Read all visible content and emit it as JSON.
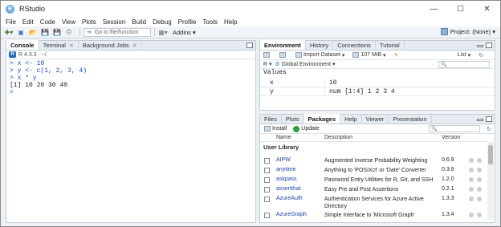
{
  "window": {
    "title": "RStudio",
    "app_icon": "R"
  },
  "menu": [
    "File",
    "Edit",
    "Code",
    "View",
    "Plots",
    "Session",
    "Build",
    "Debug",
    "Profile",
    "Tools",
    "Help"
  ],
  "toolbar": {
    "goto_placeholder": "Go to file/function",
    "addins": "Addins",
    "project": "Project: (None)"
  },
  "console_pane": {
    "tabs": [
      "Console",
      "Terminal",
      "Background Jobs"
    ],
    "r_version": "R 4.3.3 · ~/",
    "lines": [
      {
        "text": "> x <- 10",
        "kind": "cmd"
      },
      {
        "text": "> y <- c(1, 2, 3, 4)",
        "kind": "cmd"
      },
      {
        "text": "> x * y",
        "kind": "cmd"
      },
      {
        "text": "[1] 10 20 30 40",
        "kind": "out"
      },
      {
        "text": ">",
        "kind": "cmd"
      }
    ]
  },
  "env_pane": {
    "tabs": [
      "Environment",
      "History",
      "Connections",
      "Tutorial"
    ],
    "import_label": "Import Dataset",
    "memory": "107 MiB",
    "list_label": "List",
    "lang": "R",
    "scope": "Global Environment",
    "section": "Values",
    "vars": [
      {
        "name": "x",
        "value": "10"
      },
      {
        "name": "y",
        "value": "num [1:4] 1 2 3 4"
      }
    ]
  },
  "pkg_pane": {
    "tabs": [
      "Files",
      "Plots",
      "Packages",
      "Help",
      "Viewer",
      "Presentation"
    ],
    "install": "Install",
    "update": "Update",
    "columns": {
      "name": "Name",
      "description": "Description",
      "version": "Version"
    },
    "section": "User Library",
    "packages": [
      {
        "name": "AIPW",
        "description": "Augmented Inverse Probability Weighting",
        "version": "0.6.9"
      },
      {
        "name": "anytime",
        "description": "Anything to 'POSIXct' or 'Date' Converter",
        "version": "0.3.9"
      },
      {
        "name": "askpass",
        "description": "Password Entry Utilities for R, Git, and SSH",
        "version": "1.2.0"
      },
      {
        "name": "assertthat",
        "description": "Easy Pre and Post Assertions",
        "version": "0.2.1"
      },
      {
        "name": "AzureAuth",
        "description": "Authentication Services for Azure Active Directory",
        "version": "1.3.3"
      },
      {
        "name": "AzureGraph",
        "description": "Simple Interface to 'Microsoft Graph'",
        "version": "1.3.4"
      }
    ]
  }
}
